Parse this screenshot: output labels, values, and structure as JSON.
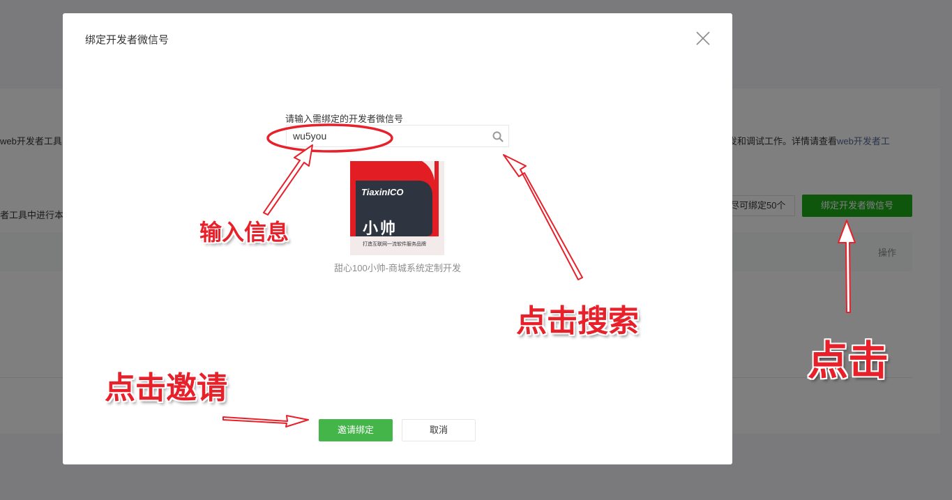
{
  "background": {
    "text_left_1": "web开发者工具",
    "text_left_2": "者工具中进行本",
    "text_right_1_prefix": "发和调试工作。详情请查看",
    "text_right_1_link": "web开发者工",
    "quota_text": "尽可绑定50个",
    "bind_button_label": "绑定开发者微信号",
    "table_column_operation": "操作"
  },
  "dialog": {
    "title": "绑定开发者微信号",
    "field_label": "请输入需绑定的开发者微信号",
    "search_value": "wu5you",
    "result": {
      "avatar_brand": "TiaxinICO",
      "avatar_name": "小帅",
      "avatar_slogan": "打造互联网一流软件服务品牌",
      "account_name": "甜心100小帅-商城系统定制开发"
    },
    "invite_button_label": "邀请绑定",
    "cancel_button_label": "取消"
  },
  "annotations": {
    "input_info": "输入信息",
    "click_search": "点击搜索",
    "click": "点击",
    "click_invite": "点击邀请"
  },
  "colors": {
    "primary_green": "#44b549",
    "annotation_red": "#e8202a",
    "overlay": "rgba(0,0,0,0.5)"
  },
  "icons": {
    "close": "close-icon",
    "search": "search-icon"
  }
}
